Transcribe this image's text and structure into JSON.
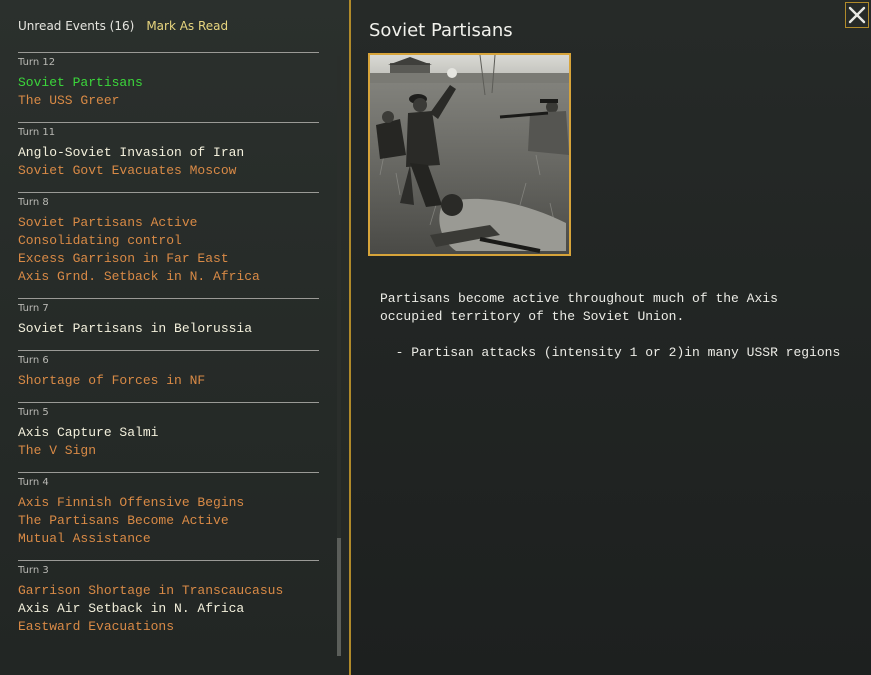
{
  "header": {
    "unread_label": "Unread Events (16)",
    "mark_read": "Mark As Read"
  },
  "turns": [
    {
      "label": "Turn 12",
      "events": [
        {
          "text": "Soviet Partisans",
          "state": "selected"
        },
        {
          "text": "The USS Greer",
          "state": "read"
        }
      ]
    },
    {
      "label": "Turn 11",
      "events": [
        {
          "text": "Anglo-Soviet Invasion of Iran",
          "state": "unread"
        },
        {
          "text": "Soviet Govt Evacuates Moscow",
          "state": "read"
        }
      ]
    },
    {
      "label": "Turn 8",
      "events": [
        {
          "text": "Soviet Partisans Active",
          "state": "read"
        },
        {
          "text": "Consolidating control",
          "state": "read"
        },
        {
          "text": "Excess Garrison in Far East",
          "state": "read"
        },
        {
          "text": "Axis Grnd. Setback in N. Africa",
          "state": "read"
        }
      ]
    },
    {
      "label": "Turn 7",
      "events": [
        {
          "text": "Soviet Partisans in Belorussia",
          "state": "unread"
        }
      ]
    },
    {
      "label": "Turn 6",
      "events": [
        {
          "text": "Shortage of Forces in NF",
          "state": "read"
        }
      ]
    },
    {
      "label": "Turn 5",
      "events": [
        {
          "text": "Axis Capture Salmi",
          "state": "unread"
        },
        {
          "text": "The V Sign",
          "state": "read"
        }
      ]
    },
    {
      "label": "Turn 4",
      "events": [
        {
          "text": "Axis Finnish Offensive Begins",
          "state": "read"
        },
        {
          "text": "The Partisans Become Active",
          "state": "read"
        },
        {
          "text": "Mutual Assistance",
          "state": "read"
        }
      ]
    },
    {
      "label": "Turn 3",
      "events": [
        {
          "text": "Garrison Shortage in Transcaucasus",
          "state": "read"
        },
        {
          "text": "Axis Air Setback in N. Africa",
          "state": "unread"
        },
        {
          "text": "Eastward Evacuations",
          "state": "read"
        }
      ]
    }
  ],
  "detail": {
    "title": "Soviet Partisans",
    "description": "Partisans become active throughout much of the Axis\noccupied territory of the Soviet Union.\n\n  - Partisan attacks (intensity 1 or 2)in many USSR regions"
  },
  "colors": {
    "read": "#d98a46",
    "unread": "#f3f0dc",
    "selected": "#3bd63b",
    "accent_border": "#b08a2a",
    "photo_border": "#d7a43a"
  },
  "icons": {
    "close": "close-icon",
    "photo": "partisans-photo"
  }
}
